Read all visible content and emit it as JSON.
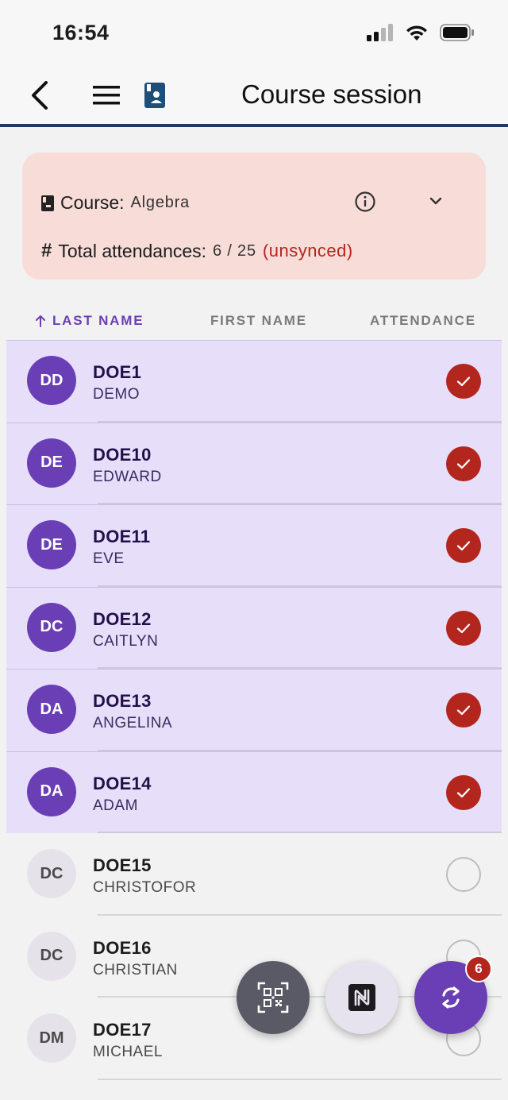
{
  "status_bar": {
    "time": "16:54"
  },
  "app_bar": {
    "title": "Course session"
  },
  "course_card": {
    "course_label": "Course:",
    "course_value": "Algebra",
    "attendances_label": "Total attendances:",
    "attendances_value": "6 / 25",
    "unsynced_label": "(unsynced)",
    "background_color": "#f8dcd8"
  },
  "table": {
    "headers": {
      "last_name": "LAST NAME",
      "first_name": "FIRST NAME",
      "attendance": "ATTENDANCE"
    },
    "sorted_by": "last_name"
  },
  "students": [
    {
      "initials": "DD",
      "last": "DOE1",
      "first": "DEMO",
      "attended": true
    },
    {
      "initials": "DE",
      "last": "DOE10",
      "first": "EDWARD",
      "attended": true
    },
    {
      "initials": "DE",
      "last": "DOE11",
      "first": "EVE",
      "attended": true
    },
    {
      "initials": "DC",
      "last": "DOE12",
      "first": "CAITLYN",
      "attended": true
    },
    {
      "initials": "DA",
      "last": "DOE13",
      "first": "ANGELINA",
      "attended": true
    },
    {
      "initials": "DA",
      "last": "DOE14",
      "first": "ADAM",
      "attended": true
    },
    {
      "initials": "DC",
      "last": "DOE15",
      "first": "CHRISTOFOR",
      "attended": false
    },
    {
      "initials": "DC",
      "last": "DOE16",
      "first": "CHRISTIAN",
      "attended": false
    },
    {
      "initials": "DM",
      "last": "DOE17",
      "first": "MICHAEL",
      "attended": false
    }
  ],
  "fabs": {
    "qr_icon": "qr-code-icon",
    "nfc_icon": "nfc-icon",
    "sync_icon": "sync-icon",
    "sync_badge": "6"
  },
  "colors": {
    "accent": "#6a3fb5",
    "danger": "#b3261e",
    "header_rule": "#1f3a5f"
  }
}
